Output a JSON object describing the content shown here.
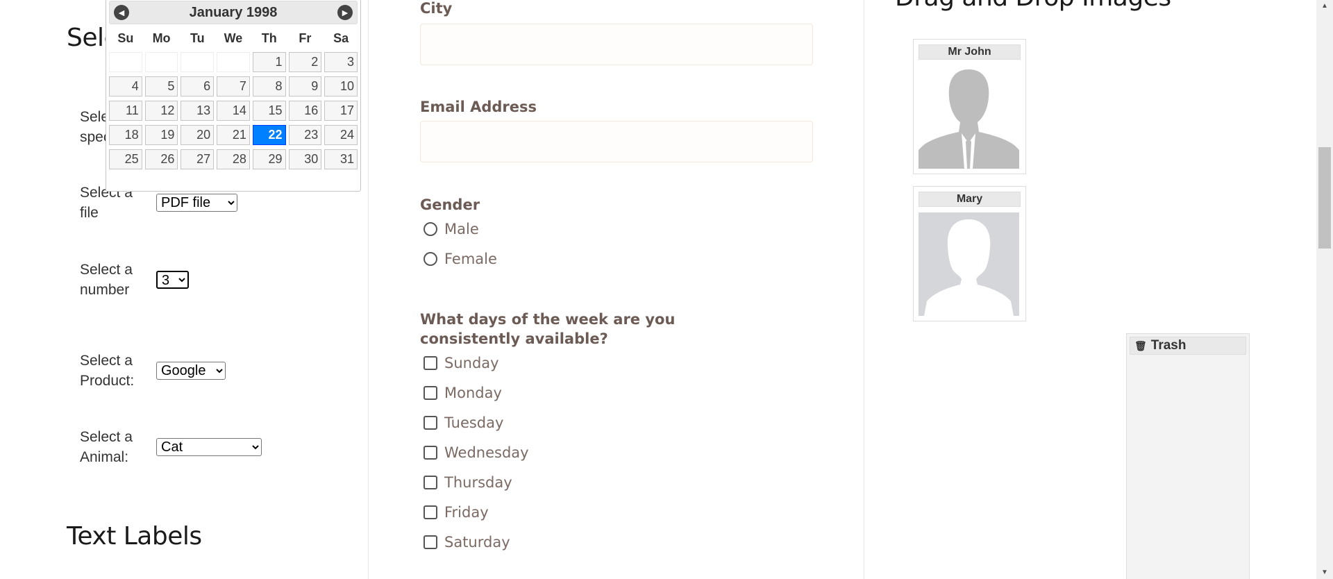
{
  "left": {
    "partial_heading": "Sele",
    "partial_label": {
      "line1": "Sele",
      "line2": "spec"
    },
    "rows": [
      {
        "label_line1": "Select a",
        "label_line2": "file",
        "value": "PDF file"
      },
      {
        "label_line1": "Select a",
        "label_line2": "number",
        "value": "3"
      },
      {
        "label_line1": "Select a",
        "label_line2": "Product:",
        "value": "Google"
      },
      {
        "label_line1": "Select a",
        "label_line2": "Animal:",
        "value": "Cat"
      }
    ],
    "text_labels_heading": "Text Labels"
  },
  "datepicker": {
    "title": "January 1998",
    "prev_icon": "triangle-left-icon",
    "next_icon": "triangle-right-icon",
    "weekdays": [
      "Su",
      "Mo",
      "Tu",
      "We",
      "Th",
      "Fr",
      "Sa"
    ],
    "leading_blanks": 4,
    "days": [
      1,
      2,
      3,
      4,
      5,
      6,
      7,
      8,
      9,
      10,
      11,
      12,
      13,
      14,
      15,
      16,
      17,
      18,
      19,
      20,
      21,
      22,
      23,
      24,
      25,
      26,
      27,
      28,
      29,
      30,
      31
    ],
    "selected_day": 22,
    "accent": "#007fff"
  },
  "middle": {
    "city_label": "City",
    "email_label": "Email Address",
    "gender_label": "Gender",
    "gender_options": [
      "Male",
      "Female"
    ],
    "days_question": "What days of the week are you consistently available?",
    "day_options": [
      "Sunday",
      "Monday",
      "Tuesday",
      "Wednesday",
      "Thursday",
      "Friday",
      "Saturday"
    ]
  },
  "right": {
    "heading": "Drag and Drop Images",
    "images": [
      {
        "caption": "Mr John",
        "icon": "male-silhouette-icon"
      },
      {
        "caption": "Mary",
        "icon": "female-silhouette-icon"
      }
    ],
    "trash_label": "Trash",
    "trash_icon": "trash-icon"
  }
}
